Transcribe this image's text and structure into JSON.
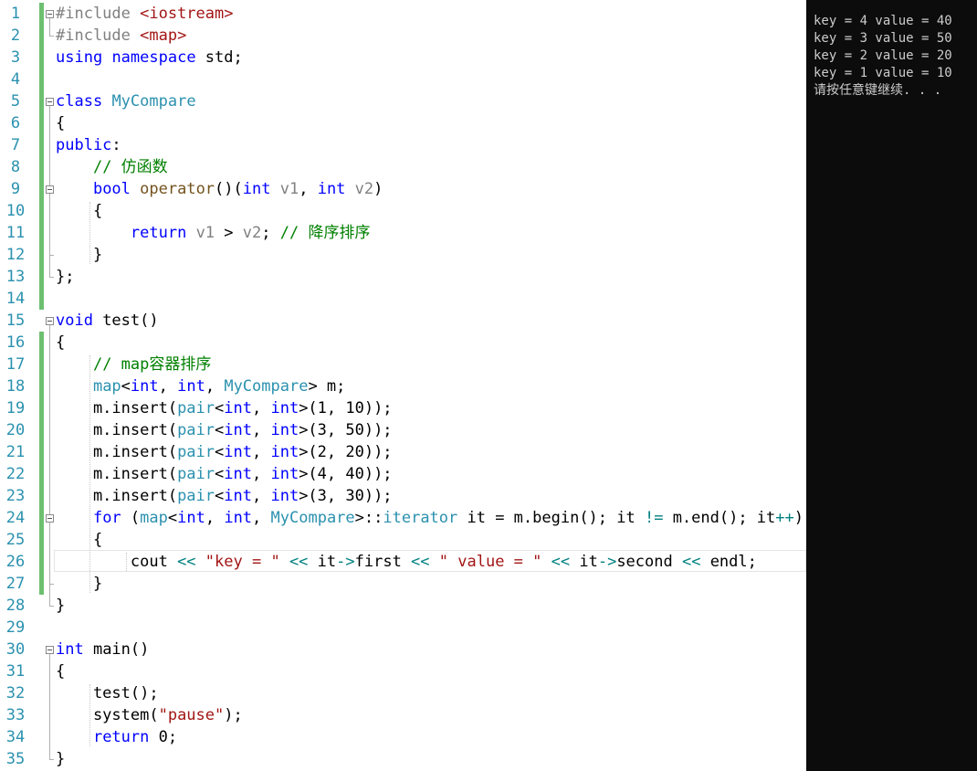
{
  "editor": {
    "line_numbers": [
      "1",
      "2",
      "3",
      "4",
      "5",
      "6",
      "7",
      "8",
      "9",
      "10",
      "11",
      "12",
      "13",
      "14",
      "15",
      "16",
      "17",
      "18",
      "19",
      "20",
      "21",
      "22",
      "23",
      "24",
      "25",
      "26",
      "27",
      "28",
      "29",
      "30",
      "31",
      "32",
      "33",
      "34",
      "35"
    ],
    "lines": [
      [
        [
          "pp",
          "#include "
        ],
        [
          "str",
          "<iostream>"
        ]
      ],
      [
        [
          "pp",
          "#include "
        ],
        [
          "str",
          "<map>"
        ]
      ],
      [
        [
          "kw",
          "using"
        ],
        [
          "t",
          " "
        ],
        [
          "kw",
          "namespace"
        ],
        [
          "t",
          " std;"
        ]
      ],
      [],
      [
        [
          "kw",
          "class"
        ],
        [
          "t",
          " "
        ],
        [
          "type",
          "MyCompare"
        ]
      ],
      [
        [
          "t",
          "{"
        ]
      ],
      [
        [
          "kw",
          "public"
        ],
        [
          "t",
          ":"
        ]
      ],
      [
        [
          "t",
          "    "
        ],
        [
          "cm",
          "// 仿函数"
        ]
      ],
      [
        [
          "t",
          "    "
        ],
        [
          "kw",
          "bool"
        ],
        [
          "t",
          " "
        ],
        [
          "fn",
          "operator"
        ],
        [
          "t",
          "()("
        ],
        [
          "kw",
          "int"
        ],
        [
          "t",
          " "
        ],
        [
          "param",
          "v1"
        ],
        [
          "t",
          ", "
        ],
        [
          "kw",
          "int"
        ],
        [
          "t",
          " "
        ],
        [
          "param",
          "v2"
        ],
        [
          "t",
          ")"
        ]
      ],
      [
        [
          "t",
          "    {"
        ]
      ],
      [
        [
          "t",
          "        "
        ],
        [
          "kw",
          "return"
        ],
        [
          "t",
          " "
        ],
        [
          "param",
          "v1"
        ],
        [
          "t",
          " > "
        ],
        [
          "param",
          "v2"
        ],
        [
          "t",
          "; "
        ],
        [
          "cm",
          "// 降序排序"
        ]
      ],
      [
        [
          "t",
          "    }"
        ]
      ],
      [
        [
          "t",
          "};"
        ]
      ],
      [],
      [
        [
          "kw",
          "void"
        ],
        [
          "t",
          " test()"
        ]
      ],
      [
        [
          "t",
          "{"
        ]
      ],
      [
        [
          "t",
          "    "
        ],
        [
          "cm",
          "// map容器排序"
        ]
      ],
      [
        [
          "t",
          "    "
        ],
        [
          "type",
          "map"
        ],
        [
          "t",
          "<"
        ],
        [
          "kw",
          "int"
        ],
        [
          "t",
          ", "
        ],
        [
          "kw",
          "int"
        ],
        [
          "t",
          ", "
        ],
        [
          "type",
          "MyCompare"
        ],
        [
          "t",
          "> m;"
        ]
      ],
      [
        [
          "t",
          "    m.insert("
        ],
        [
          "type",
          "pair"
        ],
        [
          "t",
          "<"
        ],
        [
          "kw",
          "int"
        ],
        [
          "t",
          ", "
        ],
        [
          "kw",
          "int"
        ],
        [
          "t",
          ">(1, 10));"
        ]
      ],
      [
        [
          "t",
          "    m.insert("
        ],
        [
          "type",
          "pair"
        ],
        [
          "t",
          "<"
        ],
        [
          "kw",
          "int"
        ],
        [
          "t",
          ", "
        ],
        [
          "kw",
          "int"
        ],
        [
          "t",
          ">(3, 50));"
        ]
      ],
      [
        [
          "t",
          "    m.insert("
        ],
        [
          "type",
          "pair"
        ],
        [
          "t",
          "<"
        ],
        [
          "kw",
          "int"
        ],
        [
          "t",
          ", "
        ],
        [
          "kw",
          "int"
        ],
        [
          "t",
          ">(2, 20));"
        ]
      ],
      [
        [
          "t",
          "    m.insert("
        ],
        [
          "type",
          "pair"
        ],
        [
          "t",
          "<"
        ],
        [
          "kw",
          "int"
        ],
        [
          "t",
          ", "
        ],
        [
          "kw",
          "int"
        ],
        [
          "t",
          ">(4, 40));"
        ]
      ],
      [
        [
          "t",
          "    m.insert("
        ],
        [
          "type",
          "pair"
        ],
        [
          "t",
          "<"
        ],
        [
          "kw",
          "int"
        ],
        [
          "t",
          ", "
        ],
        [
          "kw",
          "int"
        ],
        [
          "t",
          ">(3, 30));"
        ]
      ],
      [
        [
          "t",
          "    "
        ],
        [
          "kw",
          "for"
        ],
        [
          "t",
          " ("
        ],
        [
          "type",
          "map"
        ],
        [
          "t",
          "<"
        ],
        [
          "kw",
          "int"
        ],
        [
          "t",
          ", "
        ],
        [
          "kw",
          "int"
        ],
        [
          "t",
          ", "
        ],
        [
          "type",
          "MyCompare"
        ],
        [
          "t",
          ">::"
        ],
        [
          "type",
          "iterator"
        ],
        [
          "t",
          " it = m.begin(); it "
        ],
        [
          "op",
          "!="
        ],
        [
          "t",
          " m.end(); it"
        ],
        [
          "op",
          "++"
        ],
        [
          "t",
          ")"
        ]
      ],
      [
        [
          "t",
          "    {"
        ]
      ],
      [
        [
          "t",
          "        cout "
        ],
        [
          "op",
          "<<"
        ],
        [
          "t",
          " "
        ],
        [
          "str",
          "\"key = \""
        ],
        [
          "t",
          " "
        ],
        [
          "op",
          "<<"
        ],
        [
          "t",
          " it"
        ],
        [
          "op",
          "->"
        ],
        [
          "t",
          "first "
        ],
        [
          "op",
          "<<"
        ],
        [
          "t",
          " "
        ],
        [
          "str",
          "\" value = \""
        ],
        [
          "t",
          " "
        ],
        [
          "op",
          "<<"
        ],
        [
          "t",
          " it"
        ],
        [
          "op",
          "->"
        ],
        [
          "t",
          "second "
        ],
        [
          "op",
          "<<"
        ],
        [
          "t",
          " endl;"
        ]
      ],
      [
        [
          "t",
          "    }"
        ]
      ],
      [
        [
          "t",
          "}"
        ]
      ],
      [],
      [
        [
          "kw",
          "int"
        ],
        [
          "t",
          " main()"
        ]
      ],
      [
        [
          "t",
          "{"
        ]
      ],
      [
        [
          "t",
          "    test();"
        ]
      ],
      [
        [
          "t",
          "    system("
        ],
        [
          "str",
          "\"pause\""
        ],
        [
          "t",
          ");"
        ]
      ],
      [
        [
          "t",
          "    "
        ],
        [
          "kw",
          "return"
        ],
        [
          "t",
          " 0;"
        ]
      ],
      [
        [
          "t",
          "}"
        ]
      ]
    ]
  },
  "console": {
    "lines": [
      "key = 4 value = 40",
      "key = 3 value = 50",
      "key = 2 value = 20",
      "key = 1 value = 10",
      "请按任意键继续. . ."
    ]
  },
  "colors": {
    "keyword": "#0000ff",
    "type": "#2b91af",
    "string": "#a31515",
    "comment": "#008000",
    "line_number": "#2b91af",
    "change_bar": "#6cc070",
    "console_bg": "#0c0c0c",
    "console_text": "#cccccc"
  }
}
